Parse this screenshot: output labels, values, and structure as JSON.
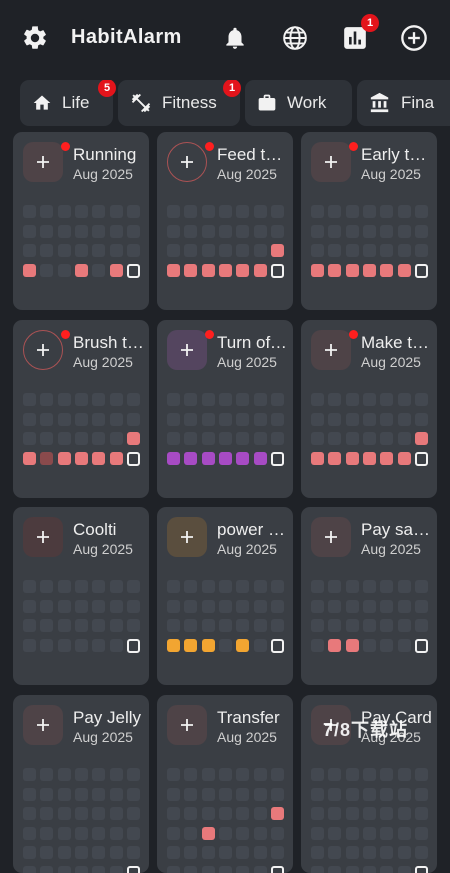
{
  "app": {
    "title": "HabitAlarm",
    "stats_badge": "1"
  },
  "tabs": [
    {
      "icon": "home-icon",
      "label": "Life",
      "badge": "5"
    },
    {
      "icon": "dumbbell-icon",
      "label": "Fitness",
      "badge": "1"
    },
    {
      "icon": "briefcase-icon",
      "label": "Work",
      "badge": ""
    },
    {
      "icon": "bank-icon",
      "label": "Fina",
      "badge": ""
    }
  ],
  "habits": [
    {
      "title": "Running",
      "date": "Aug 2025",
      "color": "#e8797b",
      "icon_bg": "#4e4347",
      "dot": true,
      "ring": false,
      "today_row": 3,
      "filled": [
        [
          3,
          0
        ],
        [
          3,
          3
        ],
        [
          3,
          5
        ]
      ],
      "dim": []
    },
    {
      "title": "Feed the cat",
      "date": "Aug 2025",
      "color": "#e8797b",
      "icon_bg": "#4e4347",
      "dot": true,
      "ring": true,
      "today_row": 3,
      "filled": [
        [
          2,
          6
        ],
        [
          3,
          0
        ],
        [
          3,
          1
        ],
        [
          3,
          2
        ],
        [
          3,
          3
        ],
        [
          3,
          4
        ],
        [
          3,
          5
        ]
      ],
      "dim": []
    },
    {
      "title": "Early to bed",
      "date": "Aug 2025",
      "color": "#e8797b",
      "icon_bg": "#4e4347",
      "dot": true,
      "ring": false,
      "today_row": 3,
      "filled": [
        [
          3,
          0
        ],
        [
          3,
          1
        ],
        [
          3,
          2
        ],
        [
          3,
          3
        ],
        [
          3,
          4
        ],
        [
          3,
          5
        ]
      ],
      "dim": []
    },
    {
      "title": "Brush teeth",
      "date": "Aug 2025",
      "color": "#e8797b",
      "icon_bg": "#4e4347",
      "dot": true,
      "ring": true,
      "today_row": 3,
      "filled": [
        [
          2,
          6
        ],
        [
          3,
          0
        ],
        [
          3,
          2
        ],
        [
          3,
          3
        ],
        [
          3,
          4
        ],
        [
          3,
          5
        ]
      ],
      "dim": [
        [
          3,
          1
        ]
      ]
    },
    {
      "title": "Turn off lights",
      "date": "Aug 2025",
      "color": "#a74bc4",
      "icon_bg": "#54455f",
      "dot": true,
      "ring": false,
      "today_row": 3,
      "filled": [
        [
          3,
          0
        ],
        [
          3,
          1
        ],
        [
          3,
          2
        ],
        [
          3,
          3
        ],
        [
          3,
          4
        ],
        [
          3,
          5
        ]
      ],
      "dim": []
    },
    {
      "title": "Make the bed",
      "date": "Aug 2025",
      "color": "#e8797b",
      "icon_bg": "#4e4347",
      "dot": true,
      "ring": false,
      "today_row": 3,
      "filled": [
        [
          2,
          6
        ],
        [
          3,
          0
        ],
        [
          3,
          1
        ],
        [
          3,
          2
        ],
        [
          3,
          3
        ],
        [
          3,
          4
        ],
        [
          3,
          5
        ]
      ],
      "dim": []
    },
    {
      "title": "Coolti",
      "date": "Aug 2025",
      "color": "#e8797b",
      "icon_bg": "#4c3b3e",
      "dot": false,
      "ring": false,
      "today_row": 3,
      "filled": [],
      "dim": []
    },
    {
      "title": "power nap",
      "date": "Aug 2025",
      "color": "#f2a531",
      "icon_bg": "#5a4e3e",
      "dot": false,
      "ring": false,
      "today_row": 3,
      "filled": [
        [
          3,
          0
        ],
        [
          3,
          1
        ],
        [
          3,
          2
        ],
        [
          3,
          4
        ]
      ],
      "dim": []
    },
    {
      "title": "Pay salary",
      "date": "Aug 2025",
      "color": "#e8797b",
      "icon_bg": "#4e4347",
      "dot": false,
      "ring": false,
      "today_row": 3,
      "filled": [
        [
          3,
          1
        ],
        [
          3,
          2
        ]
      ],
      "dim": []
    },
    {
      "title": "Pay Jelly",
      "date": "Aug 2025",
      "color": "#e8797b",
      "icon_bg": "#4e4347",
      "dot": false,
      "ring": false,
      "today_row": 5,
      "filled": [],
      "dim": []
    },
    {
      "title": "Transfer",
      "date": "Aug 2025",
      "color": "#e8797b",
      "icon_bg": "#4e4347",
      "dot": false,
      "ring": false,
      "today_row": 5,
      "filled": [
        [
          2,
          6
        ],
        [
          3,
          2
        ]
      ],
      "dim": []
    },
    {
      "title": "Pay Card",
      "date": "Aug 2025",
      "color": "#e8797b",
      "icon_bg": "#4e4347",
      "dot": false,
      "ring": false,
      "today_row": 5,
      "filled": [],
      "dim": []
    }
  ],
  "watermark": "7/8下载站"
}
